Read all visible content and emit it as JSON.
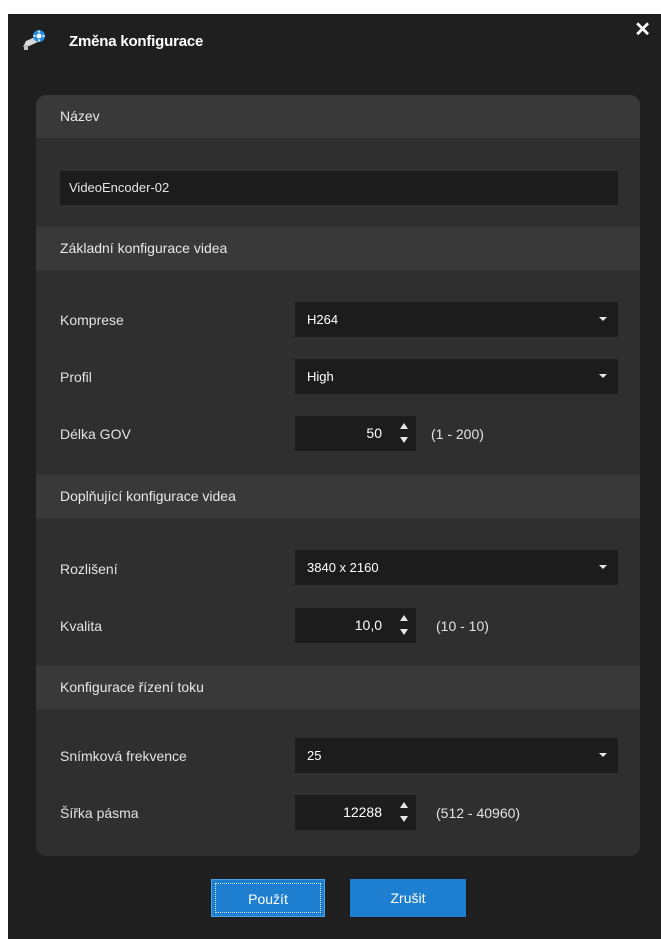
{
  "window": {
    "title": "Změna konfigurace",
    "icon": "camera-gear-icon",
    "close_label": "✕"
  },
  "name_section": {
    "header": "Název",
    "value": "VideoEncoder-02"
  },
  "basic_video": {
    "header": "Základní konfigurace videa",
    "compression": {
      "label": "Komprese",
      "value": "H264"
    },
    "profile": {
      "label": "Profil",
      "value": "High"
    },
    "gov_length": {
      "label": "Délka GOV",
      "value": "50",
      "range": "(1 - 200)"
    }
  },
  "extra_video": {
    "header": "Doplňující konfigurace videa",
    "resolution": {
      "label": "Rozlišení",
      "value": "3840 x 2160"
    },
    "quality": {
      "label": "Kvalita",
      "value": "10,0",
      "range": "(10 - 10)"
    }
  },
  "rate_control": {
    "header": "Konfigurace řízení toku",
    "frame_rate": {
      "label": "Snímková frekvence",
      "value": "25"
    },
    "bandwidth": {
      "label": "Šířka pásma",
      "value": "12288",
      "range": "(512 - 40960)"
    }
  },
  "buttons": {
    "apply": "Použít",
    "cancel": "Zrušit"
  },
  "colors": {
    "window_bg": "#1f1f1f",
    "panel_bg": "#2f2f2f",
    "section_header_bg": "#393939",
    "input_bg": "#1c1c1c",
    "accent": "#1e7fd0"
  }
}
